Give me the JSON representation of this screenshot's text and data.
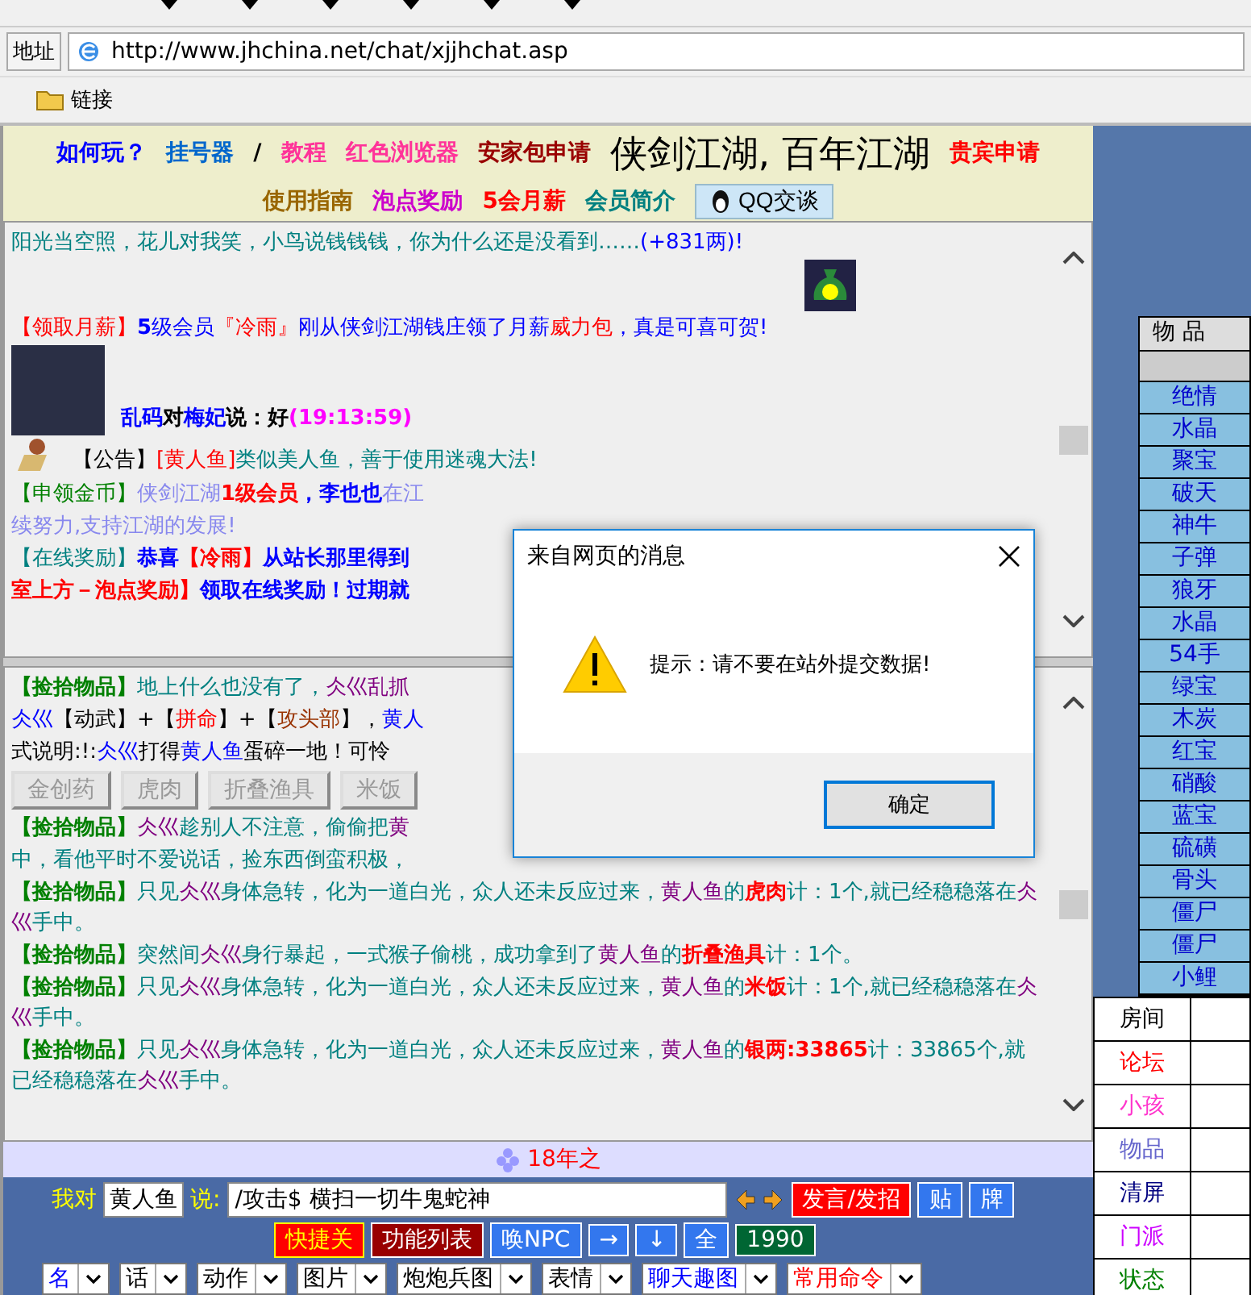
{
  "address_bar": {
    "label": "地址",
    "url": "http://www.jhchina.net/chat/xjjhchat.asp"
  },
  "links_bar": {
    "label": "链接"
  },
  "header": {
    "items_before": [
      {
        "text": "如何玩？",
        "color": "#0000ff"
      },
      {
        "text": "挂号器",
        "color": "#0066cc"
      },
      {
        "text": "/",
        "color": "#000000"
      },
      {
        "text": "教程",
        "color": "#ff3399"
      },
      {
        "text": "红色浏览器",
        "color": "#ff3399"
      }
    ],
    "apply": {
      "text": "安家包申请",
      "color": "#990000"
    },
    "title": "侠剑江湖, 百年江湖",
    "items_after": [
      {
        "text": "贵宾申请",
        "color": "#ff0000"
      },
      {
        "text": "使用指南",
        "color": "#996600"
      },
      {
        "text": "泡点奖励",
        "color": "#cc00cc"
      },
      {
        "text": "5会月薪",
        "color": "#ff0000"
      },
      {
        "text": "会员简介",
        "color": "#008080"
      }
    ],
    "qq_button": "QQ交谈"
  },
  "chat_upper": {
    "messages": [
      {
        "kind": "plain",
        "segments": [
          {
            "text": "阳光当空照，花儿对我笑，小鸟说钱钱钱，你为什么还是没看到……",
            "color": "#008080",
            "bold": false
          },
          {
            "text": "(+831两)!",
            "color": "#0000ff",
            "bold": false
          }
        ]
      },
      {
        "kind": "bag",
        "segments": [
          {
            "text": "【领取月薪】",
            "color": "#ff0000",
            "bold": false
          },
          {
            "text": "5",
            "color": "#0000ff",
            "bold": true
          },
          {
            "text": "级会员",
            "color": "#0000ff",
            "bold": false
          },
          {
            "text": "『冷雨』",
            "color": "#ff0000",
            "bold": false
          },
          {
            "text": "刚从侠剑江湖钱庄领了月薪",
            "color": "#0000ff",
            "bold": false
          },
          {
            "text": "威力包",
            "color": "#ff0000",
            "bold": false
          },
          {
            "text": "，真是可喜可贺!",
            "color": "#0000ff",
            "bold": false
          }
        ]
      },
      {
        "kind": "avatar",
        "segments": [
          {
            "text": "乱码",
            "color": "#0000ff",
            "bold": true
          },
          {
            "text": "对",
            "color": "#000000",
            "bold": true
          },
          {
            "text": "梅妃",
            "color": "#0000ff",
            "bold": true
          },
          {
            "text": "说：好",
            "color": "#000000",
            "bold": true
          },
          {
            "text": "(19:13:59)",
            "color": "#ff00ff",
            "bold": true
          }
        ]
      },
      {
        "kind": "sprite",
        "segments": [
          {
            "text": "【公告】",
            "color": "#000000",
            "bold": false
          },
          {
            "text": "[黄人鱼]",
            "color": "#ff0000",
            "bold": false
          },
          {
            "text": "类似美人鱼，善于使用迷魂大法!",
            "color": "#008080",
            "bold": false
          }
        ]
      },
      {
        "kind": "plain",
        "segments": [
          {
            "text": "【申领金币】",
            "color": "#008000",
            "bold": false
          },
          {
            "text": "侠剑江湖",
            "color": "#8888ee",
            "bold": false
          },
          {
            "text": "1级会员",
            "color": "#ff0000",
            "bold": true
          },
          {
            "text": "，李也也",
            "color": "#0000ff",
            "bold": true
          },
          {
            "text": "在江",
            "color": "#8888ee",
            "bold": false
          }
        ]
      },
      {
        "kind": "plain",
        "segments": [
          {
            "text": "续努力,支持江湖的发展!",
            "color": "#8888ee",
            "bold": false
          }
        ]
      },
      {
        "kind": "plain",
        "segments": [
          {
            "text": "【在线奖励】",
            "color": "#008080",
            "bold": false
          },
          {
            "text": "恭喜",
            "color": "#0000ff",
            "bold": true
          },
          {
            "text": "【冷雨】",
            "color": "#ff0000",
            "bold": true
          },
          {
            "text": "从站长那里得到",
            "color": "#0000ff",
            "bold": true
          }
        ]
      },
      {
        "kind": "plain",
        "segments": [
          {
            "text": "室上方－泡点奖励】",
            "color": "#ff0000",
            "bold": true
          },
          {
            "text": "领取在线奖励！过期就",
            "color": "#0000ff",
            "bold": true
          }
        ]
      }
    ]
  },
  "chat_lower": {
    "messages": [
      {
        "kind": "plain",
        "segments": [
          {
            "text": "【捡拾物品】",
            "color": "#008000",
            "bold": true
          },
          {
            "text": "地上什么也没有了，",
            "color": "#008080",
            "bold": false
          },
          {
            "text": "仌巛乱抓",
            "color": "#800080",
            "bold": false
          }
        ]
      },
      {
        "kind": "plain",
        "segments": [
          {
            "text": "仌巛",
            "color": "#0000ff",
            "bold": false
          },
          {
            "text": "【动武】+【",
            "color": "#000000",
            "bold": false
          },
          {
            "text": "拼命",
            "color": "#ff0000",
            "bold": false
          },
          {
            "text": "】+【",
            "color": "#000000",
            "bold": false
          },
          {
            "text": "攻头部",
            "color": "#993300",
            "bold": false
          },
          {
            "text": "】，",
            "color": "#000000",
            "bold": false
          },
          {
            "text": "黄人",
            "color": "#0000ff",
            "bold": false
          }
        ]
      },
      {
        "kind": "plain",
        "segments": [
          {
            "text": "式说明:!:",
            "color": "#000000",
            "bold": false
          },
          {
            "text": "仌巛",
            "color": "#0000ff",
            "bold": false
          },
          {
            "text": "打得",
            "color": "#000000",
            "bold": false
          },
          {
            "text": "黄人鱼",
            "color": "#0000ff",
            "bold": false
          },
          {
            "text": "蛋碎一地！可怜",
            "color": "#000000",
            "bold": false
          }
        ]
      },
      {
        "kind": "buttons",
        "buttons": [
          {
            "text": "金创药",
            "disabled": true
          },
          {
            "text": "虎肉",
            "disabled": true
          },
          {
            "text": "折叠渔具",
            "disabled": true
          },
          {
            "text": "米饭",
            "disabled": true
          }
        ]
      },
      {
        "kind": "plain",
        "segments": [
          {
            "text": "【捡拾物品】",
            "color": "#008000",
            "bold": true
          },
          {
            "text": "仌巛",
            "color": "#800080",
            "bold": false
          },
          {
            "text": "趁别人不注意，偷偷把",
            "color": "#008080",
            "bold": false
          },
          {
            "text": "黄",
            "color": "#800080",
            "bold": false
          }
        ]
      },
      {
        "kind": "plain",
        "segments": [
          {
            "text": "中，看他平时不爱说话，捡东西倒蛮积极，",
            "color": "#008080",
            "bold": false
          }
        ]
      },
      {
        "kind": "plain",
        "segments": [
          {
            "text": "【捡拾物品】",
            "color": "#008000",
            "bold": true
          },
          {
            "text": "只见",
            "color": "#008080",
            "bold": false
          },
          {
            "text": "仌巛",
            "color": "#800080",
            "bold": false
          },
          {
            "text": "身体急转，化为一道白光，众人还未反应过来，",
            "color": "#008080",
            "bold": false
          },
          {
            "text": "黄人鱼",
            "color": "#800080",
            "bold": false
          },
          {
            "text": "的",
            "color": "#008080",
            "bold": false
          },
          {
            "text": "虎肉",
            "color": "#ff0000",
            "bold": true
          },
          {
            "text": "计：1个,就已经稳稳落在",
            "color": "#008080",
            "bold": false
          },
          {
            "text": "仌巛",
            "color": "#800080",
            "bold": false
          },
          {
            "text": "手中。",
            "color": "#008080",
            "bold": false
          }
        ]
      },
      {
        "kind": "plain",
        "segments": [
          {
            "text": "【捡拾物品】",
            "color": "#008000",
            "bold": true
          },
          {
            "text": "突然间",
            "color": "#008080",
            "bold": false
          },
          {
            "text": "仌巛",
            "color": "#800080",
            "bold": false
          },
          {
            "text": "身行暴起，一式猴子偷桃，成功拿到了",
            "color": "#008080",
            "bold": false
          },
          {
            "text": "黄人鱼",
            "color": "#800080",
            "bold": false
          },
          {
            "text": "的",
            "color": "#008080",
            "bold": false
          },
          {
            "text": "折叠渔具",
            "color": "#ff0000",
            "bold": true
          },
          {
            "text": "计：1个。",
            "color": "#008080",
            "bold": false
          }
        ]
      },
      {
        "kind": "plain",
        "segments": [
          {
            "text": "【捡拾物品】",
            "color": "#008000",
            "bold": true
          },
          {
            "text": "只见",
            "color": "#008080",
            "bold": false
          },
          {
            "text": "仌巛",
            "color": "#800080",
            "bold": false
          },
          {
            "text": "身体急转，化为一道白光，众人还未反应过来，",
            "color": "#008080",
            "bold": false
          },
          {
            "text": "黄人鱼",
            "color": "#800080",
            "bold": false
          },
          {
            "text": "的",
            "color": "#008080",
            "bold": false
          },
          {
            "text": "米饭",
            "color": "#ff0000",
            "bold": true
          },
          {
            "text": "计：1个,就已经稳稳落在",
            "color": "#008080",
            "bold": false
          },
          {
            "text": "仌巛",
            "color": "#800080",
            "bold": false
          },
          {
            "text": "手中。",
            "color": "#008080",
            "bold": false
          }
        ]
      },
      {
        "kind": "plain",
        "segments": [
          {
            "text": "【捡拾物品】",
            "color": "#008000",
            "bold": true
          },
          {
            "text": "只见",
            "color": "#008080",
            "bold": false
          },
          {
            "text": "仌巛",
            "color": "#800080",
            "bold": false
          },
          {
            "text": "身体急转，化为一道白光，众人还未反应过来，",
            "color": "#008080",
            "bold": false
          },
          {
            "text": "黄人鱼",
            "color": "#800080",
            "bold": false
          },
          {
            "text": "的",
            "color": "#008080",
            "bold": false
          },
          {
            "text": "银两:33865",
            "color": "#ff0000",
            "bold": true
          },
          {
            "text": "计：33865个,就已经稳稳落在",
            "color": "#008080",
            "bold": false
          },
          {
            "text": "仌巛",
            "color": "#800080",
            "bold": false
          },
          {
            "text": "手中。",
            "color": "#008080",
            "bold": false
          }
        ]
      }
    ]
  },
  "promo": {
    "text": "18年之"
  },
  "controls": {
    "to_label": "我对",
    "target": "黄人鱼",
    "say_label": "说:",
    "message": "/攻击$ 横扫一切牛鬼蛇神",
    "row1_buttons": [
      {
        "text": "发言/发招",
        "kind": "red"
      },
      {
        "text": "贴",
        "kind": "blue"
      },
      {
        "text": "牌",
        "kind": "blue"
      }
    ],
    "row2_buttons": [
      {
        "text": "快捷关",
        "kind": "hot"
      },
      {
        "text": "功能列表",
        "kind": "dark"
      },
      {
        "text": "唤NPC",
        "kind": "blue"
      },
      {
        "text": "→",
        "kind": "blue"
      },
      {
        "text": "↓",
        "kind": "blue"
      },
      {
        "text": "全",
        "kind": "blue"
      },
      {
        "text": "1990",
        "kind": "green"
      }
    ],
    "selects": [
      {
        "text": "名",
        "color": "#0000ff"
      },
      {
        "text": "话",
        "color": "#000000"
      },
      {
        "text": "动作",
        "color": "#000000"
      },
      {
        "text": "图片",
        "color": "#000000"
      },
      {
        "text": "炮炮兵图",
        "color": "#000000"
      },
      {
        "text": "表情",
        "color": "#000000"
      },
      {
        "text": "聊天趣图",
        "color": "#0000ff"
      },
      {
        "text": "常用命令",
        "color": "#ff0000"
      }
    ]
  },
  "items_table": {
    "header": "物 品",
    "items": [
      "绝情",
      "水晶",
      "聚宝",
      "破天",
      "神牛",
      "子弹",
      "狼牙",
      "水晶",
      "54手",
      "绿宝",
      "木炭",
      "红宝",
      "硝酸",
      "蓝宝",
      "硫磺",
      "骨头",
      "僵尸",
      "僵尸",
      "小鲤"
    ]
  },
  "room_table": {
    "rows": [
      {
        "text": "房间",
        "color": "#000000"
      },
      {
        "text": "论坛",
        "color": "#ff0000"
      },
      {
        "text": "小孩",
        "color": "#ff33cc"
      },
      {
        "text": "物品",
        "color": "#6666cc"
      },
      {
        "text": "清屏",
        "color": "#000080"
      },
      {
        "text": "门派",
        "color": "#cc00ff"
      },
      {
        "text": "状态",
        "color": "#008000"
      }
    ]
  },
  "dialog": {
    "title": "来自网页的消息",
    "message": "提示：请不要在站外提交数据!",
    "ok_button": "确定"
  }
}
